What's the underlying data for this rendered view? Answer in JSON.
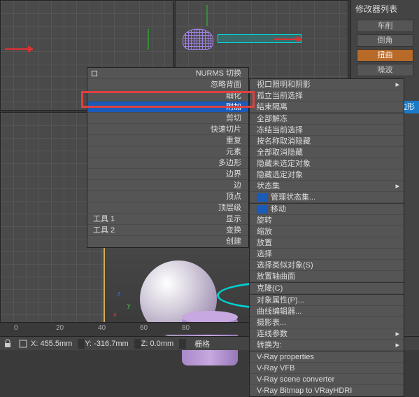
{
  "right_panel": {
    "title": "修改器列表",
    "buttons": [
      "车削",
      "倒角",
      "扭曲",
      "噪波"
    ],
    "active_index": 2,
    "blue_label": "多边形"
  },
  "menu1": {
    "items": [
      {
        "label": "NURMS 切换"
      },
      {
        "label": "忽略背面"
      },
      {
        "label": "细化"
      },
      {
        "label": "附加",
        "highlight": true
      },
      {
        "label": "剪切"
      },
      {
        "label": "快速切片"
      },
      {
        "label": "重复"
      },
      {
        "label": "元素"
      },
      {
        "label": "多边形"
      },
      {
        "label": "边界"
      },
      {
        "label": "边"
      },
      {
        "label": "顶点"
      },
      {
        "label": "顶层级"
      }
    ],
    "tools": [
      {
        "left": "工具 1",
        "right": "显示"
      },
      {
        "left": "工具 2",
        "right": "变换"
      }
    ],
    "create": "创建"
  },
  "menu2": {
    "items": [
      {
        "label": "视口照明和阴影",
        "arrow": true
      },
      {
        "label": "孤立当前选择"
      },
      {
        "label": "结束隔离"
      },
      {
        "sep": true
      },
      {
        "label": "全部解冻"
      },
      {
        "label": "冻结当前选择"
      },
      {
        "label": "按名称取消隐藏"
      },
      {
        "label": "全部取消隐藏"
      },
      {
        "label": "隐藏未选定对象"
      },
      {
        "label": "隐藏选定对象"
      },
      {
        "label": "状态集",
        "arrow": true
      },
      {
        "label": "管理状态集...",
        "bluewin": true
      },
      {
        "sep": true
      },
      {
        "label": "移动",
        "bluewin": true
      },
      {
        "label": "旋转"
      },
      {
        "label": "缩放"
      },
      {
        "label": "放置"
      },
      {
        "label": "选择"
      },
      {
        "label": "选择类似对象(S)"
      },
      {
        "label": "放置轴曲面"
      },
      {
        "sep": true
      },
      {
        "label": "克隆(C)"
      },
      {
        "sep": true
      },
      {
        "label": "对象属性(P)..."
      },
      {
        "label": "曲线编辑器..."
      },
      {
        "label": "摄影表..."
      },
      {
        "label": "连线参数",
        "arrow": true
      },
      {
        "label": "转换为:",
        "arrow": true
      },
      {
        "sep": true
      },
      {
        "label": "V-Ray properties"
      },
      {
        "label": "V-Ray VFB"
      },
      {
        "label": "V-Ray scene converter"
      },
      {
        "label": "V-Ray Bitmap to VRayHDRI"
      }
    ]
  },
  "ruler": {
    "ticks": [
      {
        "pos": 20,
        "label": "0"
      },
      {
        "pos": 80,
        "label": "20"
      },
      {
        "pos": 140,
        "label": "40"
      },
      {
        "pos": 200,
        "label": "60"
      },
      {
        "pos": 260,
        "label": "80"
      }
    ]
  },
  "status": {
    "x": "X: 455.5mm",
    "y": "Y: -316.7mm",
    "z": "Z: 0.0mm",
    "grid": "栅格"
  },
  "colors": {
    "highlight_bg": "#1a5ab8",
    "active_btn": "#b86a28",
    "red_box": "#e04040"
  }
}
